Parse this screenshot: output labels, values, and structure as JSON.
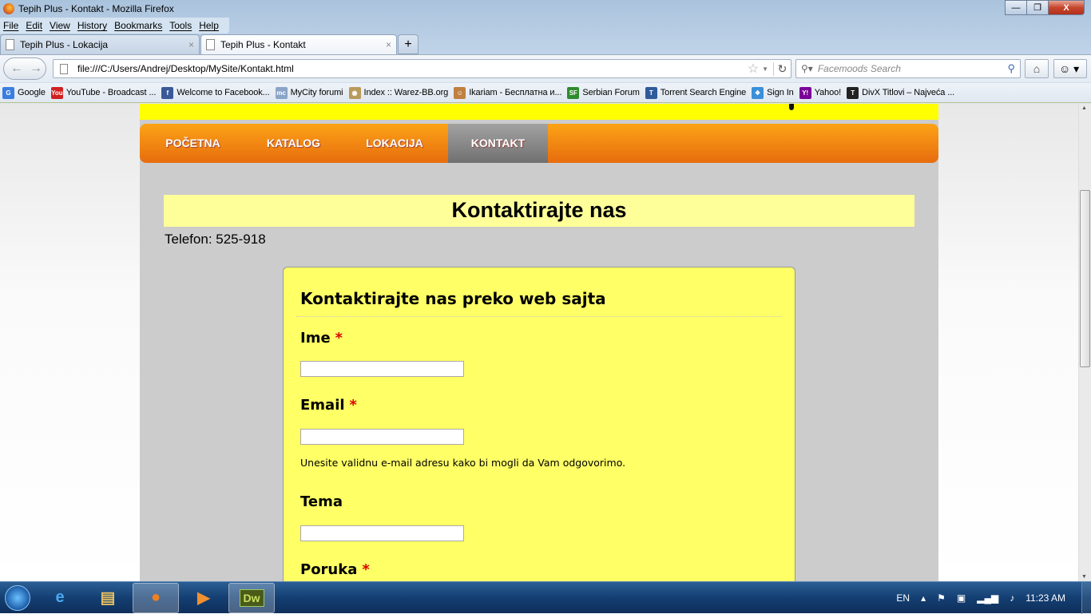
{
  "window": {
    "title": "Tepih Plus - Kontakt - Mozilla Firefox",
    "minimize": "—",
    "maximize": "❐",
    "close": "X"
  },
  "menu": [
    "File",
    "Edit",
    "View",
    "History",
    "Bookmarks",
    "Tools",
    "Help"
  ],
  "tabs": [
    {
      "label": "Tepih Plus - Lokacija",
      "close": "×"
    },
    {
      "label": "Tepih Plus - Kontakt",
      "close": "×"
    }
  ],
  "new_tab": "+",
  "url": "file:///C:/Users/Andrej/Desktop/MySite/Kontakt.html",
  "search_placeholder": "Facemoods Search",
  "bookmarks": [
    {
      "label": "Google",
      "icon": "google-icon",
      "color": "#3b7de0",
      "glyph": "G"
    },
    {
      "label": "YouTube - Broadcast ...",
      "icon": "youtube-icon",
      "color": "#d02020",
      "glyph": "You"
    },
    {
      "label": "Welcome to Facebook...",
      "icon": "facebook-icon",
      "color": "#3b5998",
      "glyph": "f"
    },
    {
      "label": "MyCity forumi",
      "icon": "mycity-icon",
      "color": "#8aa4c8",
      "glyph": "mc"
    },
    {
      "label": "Index :: Warez-BB.org",
      "icon": "warez-icon",
      "color": "#b99a5a",
      "glyph": "◉"
    },
    {
      "label": "Ikariam - Бесплатна и...",
      "icon": "ikariam-icon",
      "color": "#c08040",
      "glyph": "☺"
    },
    {
      "label": "Serbian Forum",
      "icon": "serbian-forum-icon",
      "color": "#2e8b2e",
      "glyph": "SF"
    },
    {
      "label": "Torrent Search Engine",
      "icon": "torrentz-icon",
      "color": "#2f5b9a",
      "glyph": "T"
    },
    {
      "label": "Sign In",
      "icon": "windows-icon",
      "color": "#3a8fd8",
      "glyph": "❖"
    },
    {
      "label": "Yahoo!",
      "icon": "yahoo-icon",
      "color": "#7b0099",
      "glyph": "Y!"
    },
    {
      "label": "DivX Titlovi – Najveća ...",
      "icon": "divx-icon",
      "color": "#222222",
      "glyph": "T"
    }
  ],
  "site": {
    "nav": [
      {
        "label": "POČETNA"
      },
      {
        "label": "KATALOG"
      },
      {
        "label": "LOKACIJA"
      },
      {
        "label": "KONTAKT",
        "active": true
      }
    ],
    "heading": "Kontaktirajte nas",
    "phone": "Telefon: 525-918",
    "form": {
      "title": "Kontaktirajte nas preko web sajta",
      "required_mark": "*",
      "fields": [
        {
          "label": "Ime",
          "required": true,
          "value": ""
        },
        {
          "label": "Email",
          "required": true,
          "value": "",
          "hint": "Unesite validnu e-mail adresu kako bi mogli da Vam odgovorimo."
        },
        {
          "label": "Tema",
          "required": false,
          "value": ""
        },
        {
          "label": "Poruka",
          "required": true
        }
      ]
    }
  },
  "taskbar": {
    "apps": [
      "internet-explorer",
      "firefox",
      "media-player",
      "windows-explorer",
      "dreamweaver"
    ],
    "dw_label": "Dw",
    "lang": "EN",
    "time": "11:23 AM"
  }
}
